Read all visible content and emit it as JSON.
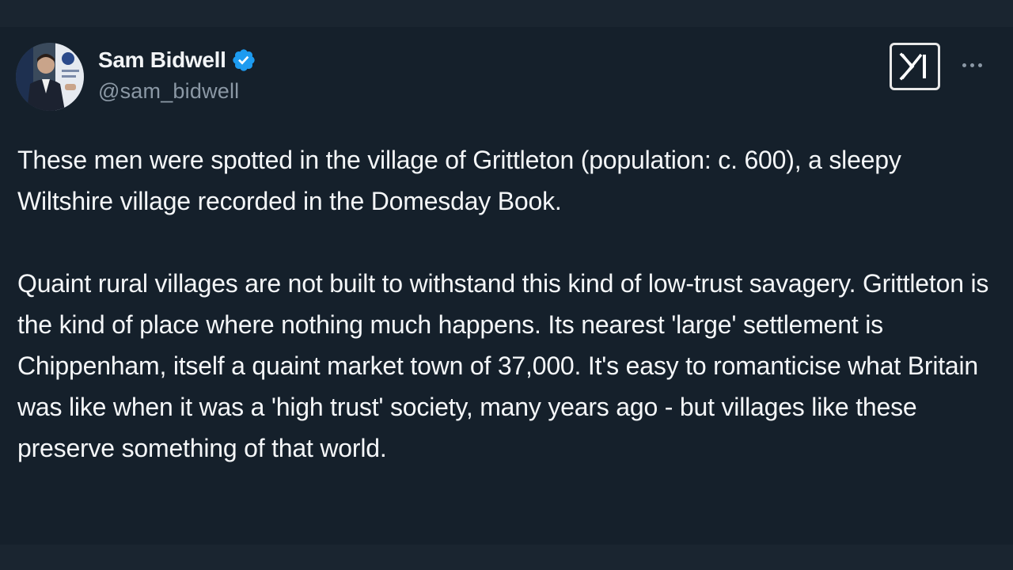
{
  "author": {
    "display_name": "Sam Bidwell",
    "handle": "@sam_bidwell",
    "verified": true,
    "avatar_icon": "profile-photo"
  },
  "post": {
    "paragraphs": [
      "These men were spotted in the village of Grittleton (population: c. 600), a sleepy Wiltshire village recorded in the Domesday Book.",
      "Quaint rural villages are not built to withstand this kind of low-trust savagery. Grittleton is the kind of place where nothing much happens. Its nearest 'large' settlement is Chippenham, itself a quaint market town of 37,000. It's easy to romanticise what Britain was like when it was a 'high trust' society, many years ago - but villages like these preserve something of that world."
    ]
  },
  "icons": {
    "verified": "verified-badge-icon",
    "x_logo": "x-logo-icon",
    "more": "more-options-icon"
  },
  "colors": {
    "background": "#15202b",
    "verified_blue": "#1d9bf0",
    "text_primary": "#f4f6f8",
    "text_secondary": "#8b98a5"
  }
}
